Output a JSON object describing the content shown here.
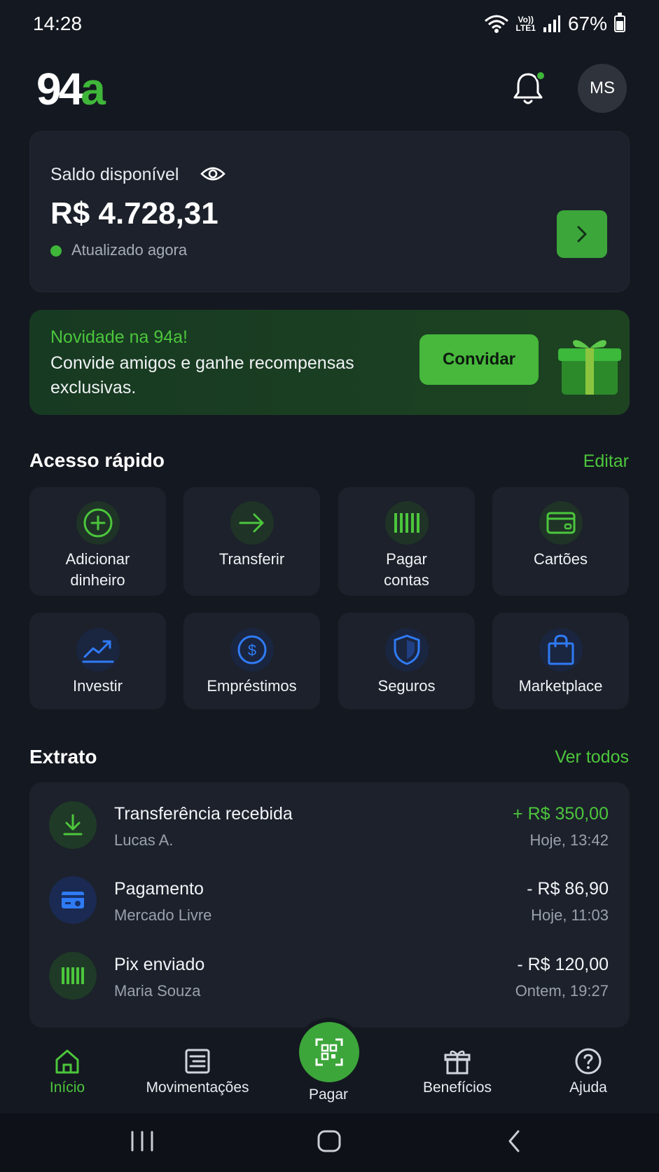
{
  "status_bar": {
    "time": "14:28",
    "network_top": "Vo))",
    "network_bottom": "LTE1",
    "battery": "67%"
  },
  "header": {
    "logo_digits": "94",
    "logo_letter": "a",
    "avatar_initials": "MS"
  },
  "balance": {
    "label": "Saldo disponível",
    "value": "R$ 4.728,31",
    "status": "Atualizado agora"
  },
  "promo": {
    "title": "Novidade na 94a!",
    "text": "Convide amigos e ganhe recompensas exclusivas.",
    "button": "Convidar"
  },
  "quick_access": {
    "title": "Acesso rápido",
    "edit": "Editar",
    "tiles": [
      {
        "label": "Adicionar dinheiro",
        "icon": "plus-circle-icon"
      },
      {
        "label": "Transferir",
        "icon": "arrow-right-icon"
      },
      {
        "label": "Pagar contas",
        "icon": "barcode-icon"
      },
      {
        "label": "Cartões",
        "icon": "card-icon"
      },
      {
        "label": "Investir",
        "icon": "trend-up-icon"
      },
      {
        "label": "Empréstimos",
        "icon": "dollar-circle-icon"
      },
      {
        "label": "Seguros",
        "icon": "shield-icon"
      },
      {
        "label": "Marketplace",
        "icon": "shopping-bag-icon"
      }
    ]
  },
  "statement": {
    "title": "Extrato",
    "see_all": "Ver todos",
    "transactions": [
      {
        "title": "Transferência recebida",
        "sub": "Lucas A.",
        "amount": "+ R$ 350,00",
        "time": "Hoje, 13:42",
        "icon": "download-icon"
      },
      {
        "title": "Pagamento",
        "sub": "Mercado Livre",
        "amount": "- R$ 86,90",
        "time": "Hoje, 11:03",
        "icon": "wallet-icon"
      },
      {
        "title": "Pix enviado",
        "sub": "Maria Souza",
        "amount": "- R$ 120,00",
        "time": "Ontem, 19:27",
        "icon": "barcode-icon"
      }
    ]
  },
  "bottom_nav": {
    "items": [
      {
        "label": "Início",
        "icon": "home-icon",
        "active": true
      },
      {
        "label": "Movimentações",
        "icon": "list-icon"
      },
      {
        "label": "Pagar",
        "icon": "qr-code-icon"
      },
      {
        "label": "Benefícios",
        "icon": "gift-icon"
      },
      {
        "label": "Ajuda",
        "icon": "help-icon"
      }
    ]
  },
  "colors": {
    "background": "#141820",
    "card": "#1c212b",
    "accent_green": "#3fb63a",
    "accent_blue": "#2f7bf5"
  }
}
